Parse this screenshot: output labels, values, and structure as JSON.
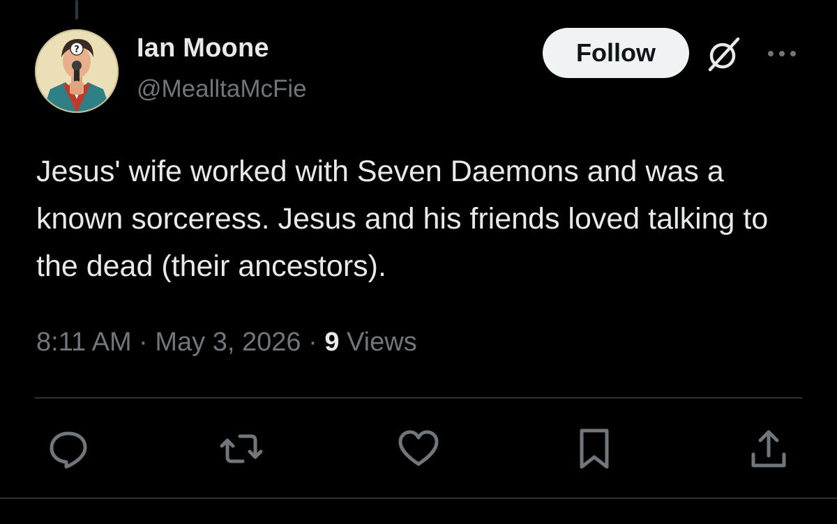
{
  "author": {
    "name": "Ian Moone",
    "handle": "@MealltaMcFie",
    "avatar_icon": "avatar-illustration"
  },
  "header": {
    "follow_label": "Follow",
    "grok_icon": "grok-icon",
    "more_icon": "more-dots-icon"
  },
  "tweet": {
    "text": "Jesus' wife worked with Seven Daemons and was a known sorceress. Jesus and his friends loved talking to the dead (their ancestors).",
    "time": "8:11 AM",
    "date": "May 3, 2026",
    "views_count": "9",
    "views_label": "Views"
  },
  "actions": [
    {
      "name": "reply",
      "icon": "reply-icon"
    },
    {
      "name": "retweet",
      "icon": "retweet-icon"
    },
    {
      "name": "like",
      "icon": "heart-icon"
    },
    {
      "name": "bookmark",
      "icon": "bookmark-icon"
    },
    {
      "name": "share",
      "icon": "share-icon"
    }
  ],
  "colors": {
    "background": "#000000",
    "text_primary": "#e7e9ea",
    "text_secondary": "#71767b",
    "divider": "#2f3336",
    "follow_bg": "#eff3f4"
  }
}
